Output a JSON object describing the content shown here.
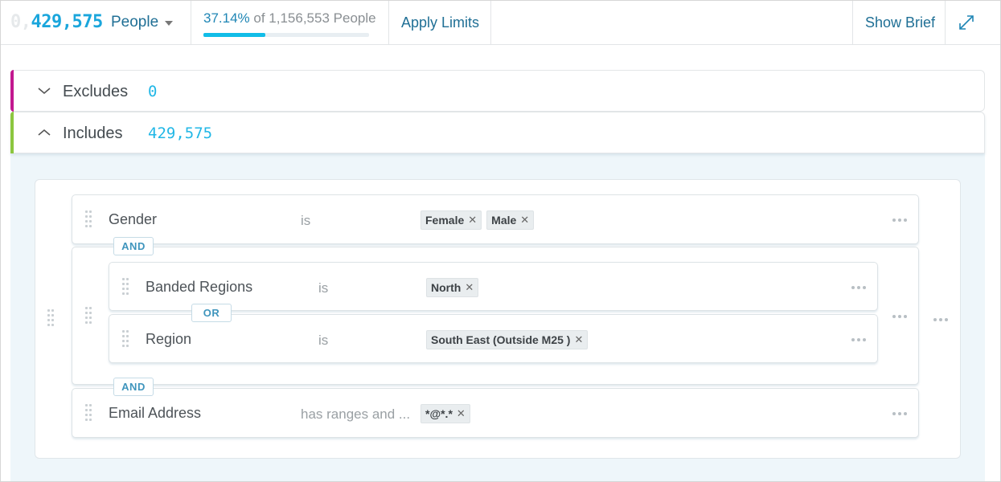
{
  "header": {
    "count_ghost": "0,",
    "count": "429,575",
    "entity_select": "People",
    "percent": "37.14%",
    "of_text": " of 1,156,553 People",
    "progress_percent": 37.14,
    "apply_limits": "Apply Limits",
    "show_brief": "Show Brief"
  },
  "excludes": {
    "label": "Excludes",
    "count": "0"
  },
  "includes": {
    "label": "Includes",
    "count": "429,575"
  },
  "rules": {
    "gender": {
      "field": "Gender",
      "op": "is",
      "tags": [
        "Female",
        "Male"
      ]
    },
    "banded_regions": {
      "field": "Banded Regions",
      "op": "is",
      "tags": [
        "North"
      ]
    },
    "region": {
      "field": "Region",
      "op": "is",
      "tags": [
        "South East (Outside M25 )"
      ]
    },
    "email": {
      "field": "Email Address",
      "op": "has ranges and ...",
      "tags": [
        "*@*.*"
      ]
    }
  },
  "connectors": {
    "and1": "AND",
    "or1": "OR",
    "and2": "AND"
  },
  "colors": {
    "excludes_accent": "#c2188f",
    "includes_accent": "#8cc63f",
    "brand_blue": "#1aa6dc"
  }
}
